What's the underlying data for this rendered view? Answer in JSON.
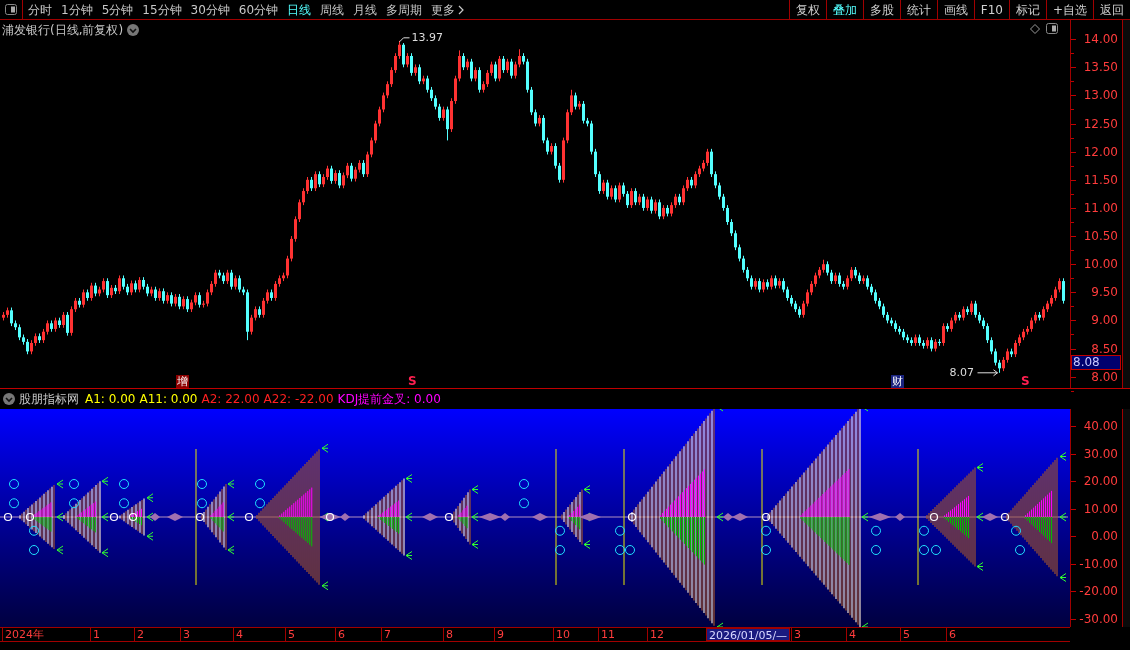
{
  "toolbar": {
    "periods": [
      {
        "label": "分时",
        "selected": false
      },
      {
        "label": "1分钟",
        "selected": false
      },
      {
        "label": "5分钟",
        "selected": false
      },
      {
        "label": "15分钟",
        "selected": false
      },
      {
        "label": "30分钟",
        "selected": false
      },
      {
        "label": "60分钟",
        "selected": false
      },
      {
        "label": "日线",
        "selected": true
      },
      {
        "label": "周线",
        "selected": false
      },
      {
        "label": "月线",
        "selected": false
      },
      {
        "label": "多周期",
        "selected": false
      }
    ],
    "more": "更多",
    "buttons": [
      {
        "label": "复权",
        "selected": false
      },
      {
        "label": "叠加",
        "selected": true
      },
      {
        "label": "多股",
        "selected": false
      },
      {
        "label": "统计",
        "selected": false
      },
      {
        "label": "画线",
        "selected": false
      },
      {
        "label": "F10",
        "selected": false
      },
      {
        "label": "标记",
        "selected": false
      },
      {
        "label": "+自选",
        "selected": false
      },
      {
        "label": "返回",
        "selected": false
      }
    ]
  },
  "chart": {
    "title": "浦发银行(日线,前复权)",
    "high_label": "13.97",
    "low_label": "8.07",
    "price_tag": "8.08",
    "markers": [
      {
        "text": "增",
        "kind": "event"
      },
      {
        "text": "S",
        "kind": "signal"
      },
      {
        "text": "财",
        "kind": "event"
      },
      {
        "text": "S",
        "kind": "signal"
      }
    ],
    "chart_data": {
      "type": "candlestick",
      "ohlc": [
        [
          9.05,
          9.15,
          9.0,
          9.1
        ],
        [
          9.1,
          9.23,
          9.05,
          9.18
        ],
        [
          9.18,
          9.23,
          8.9,
          8.95
        ],
        [
          8.95,
          9.0,
          8.83,
          8.88
        ],
        [
          8.88,
          8.93,
          8.65,
          8.7
        ],
        [
          8.7,
          8.75,
          8.57,
          8.62
        ],
        [
          8.62,
          8.67,
          8.4,
          8.45
        ],
        [
          8.45,
          8.65,
          8.4,
          8.6
        ],
        [
          8.6,
          8.77,
          8.55,
          8.72
        ],
        [
          8.72,
          8.77,
          8.6,
          8.65
        ],
        [
          8.65,
          8.85,
          8.6,
          8.8
        ],
        [
          8.8,
          9.0,
          8.75,
          8.95
        ],
        [
          8.95,
          9.0,
          8.8,
          8.85
        ],
        [
          8.85,
          9.05,
          8.8,
          9.0
        ],
        [
          9.0,
          9.05,
          8.87,
          8.92
        ],
        [
          8.92,
          9.15,
          8.87,
          9.1
        ],
        [
          9.1,
          9.15,
          8.73,
          8.78
        ],
        [
          8.78,
          9.25,
          8.73,
          9.2
        ],
        [
          9.2,
          9.4,
          9.15,
          9.35
        ],
        [
          9.35,
          9.4,
          9.23,
          9.28
        ],
        [
          9.28,
          9.55,
          9.23,
          9.5
        ],
        [
          9.5,
          9.55,
          9.35,
          9.4
        ],
        [
          9.4,
          9.67,
          9.35,
          9.62
        ],
        [
          9.62,
          9.67,
          9.43,
          9.48
        ],
        [
          9.48,
          9.6,
          9.43,
          9.55
        ],
        [
          9.55,
          9.75,
          9.5,
          9.7
        ],
        [
          9.7,
          9.75,
          9.4,
          9.45
        ],
        [
          9.45,
          9.63,
          9.4,
          9.58
        ],
        [
          9.58,
          9.63,
          9.47,
          9.52
        ],
        [
          9.52,
          9.8,
          9.47,
          9.75
        ],
        [
          9.75,
          9.8,
          9.55,
          9.6
        ],
        [
          9.6,
          9.65,
          9.45,
          9.5
        ],
        [
          9.5,
          9.71,
          9.45,
          9.66
        ],
        [
          9.66,
          9.71,
          9.5,
          9.55
        ],
        [
          9.55,
          9.77,
          9.5,
          9.72
        ],
        [
          9.72,
          9.77,
          9.55,
          9.6
        ],
        [
          9.6,
          9.65,
          9.43,
          9.48
        ],
        [
          9.48,
          9.6,
          9.43,
          9.55
        ],
        [
          9.55,
          9.6,
          9.35,
          9.4
        ],
        [
          9.4,
          9.57,
          9.35,
          9.52
        ],
        [
          9.52,
          9.57,
          9.3,
          9.35
        ],
        [
          9.35,
          9.5,
          9.3,
          9.45
        ],
        [
          9.45,
          9.5,
          9.25,
          9.3
        ],
        [
          9.3,
          9.47,
          9.25,
          9.42
        ],
        [
          9.42,
          9.47,
          9.2,
          9.25
        ],
        [
          9.25,
          9.43,
          9.2,
          9.38
        ],
        [
          9.38,
          9.43,
          9.15,
          9.2
        ],
        [
          9.2,
          9.37,
          9.15,
          9.32
        ],
        [
          9.32,
          9.5,
          9.27,
          9.45
        ],
        [
          9.45,
          9.5,
          9.23,
          9.28
        ],
        [
          9.28,
          9.35,
          9.23,
          9.3
        ],
        [
          9.3,
          9.55,
          9.25,
          9.5
        ],
        [
          9.5,
          9.7,
          9.45,
          9.65
        ],
        [
          9.65,
          9.9,
          9.6,
          9.85
        ],
        [
          9.85,
          9.9,
          9.75,
          9.8
        ],
        [
          9.8,
          9.85,
          9.65,
          9.7
        ],
        [
          9.7,
          9.9,
          9.65,
          9.85
        ],
        [
          9.85,
          9.9,
          9.55,
          9.6
        ],
        [
          9.6,
          9.8,
          9.55,
          9.75
        ],
        [
          9.75,
          9.8,
          9.5,
          9.55
        ],
        [
          9.55,
          9.6,
          9.45,
          9.5
        ],
        [
          9.5,
          9.55,
          8.65,
          8.8
        ],
        [
          8.8,
          9.1,
          8.75,
          9.05
        ],
        [
          9.05,
          9.25,
          9.0,
          9.2
        ],
        [
          9.2,
          9.25,
          9.05,
          9.1
        ],
        [
          9.1,
          9.4,
          9.05,
          9.35
        ],
        [
          9.35,
          9.55,
          9.3,
          9.5
        ],
        [
          9.5,
          9.55,
          9.35,
          9.4
        ],
        [
          9.4,
          9.7,
          9.35,
          9.65
        ],
        [
          9.65,
          9.8,
          9.6,
          9.75
        ],
        [
          9.75,
          9.85,
          9.7,
          9.8
        ],
        [
          9.8,
          10.15,
          9.75,
          10.1
        ],
        [
          10.1,
          10.5,
          10.05,
          10.45
        ],
        [
          10.45,
          10.85,
          10.4,
          10.8
        ],
        [
          10.8,
          11.15,
          10.75,
          11.1
        ],
        [
          11.1,
          11.35,
          11.05,
          11.3
        ],
        [
          11.3,
          11.55,
          11.25,
          11.5
        ],
        [
          11.5,
          11.55,
          11.3,
          11.35
        ],
        [
          11.35,
          11.65,
          11.3,
          11.6
        ],
        [
          11.6,
          11.65,
          11.37,
          11.42
        ],
        [
          11.42,
          11.6,
          11.37,
          11.55
        ],
        [
          11.55,
          11.75,
          11.5,
          11.7
        ],
        [
          11.7,
          11.75,
          11.43,
          11.48
        ],
        [
          11.48,
          11.67,
          11.43,
          11.62
        ],
        [
          11.62,
          11.67,
          11.35,
          11.4
        ],
        [
          11.4,
          11.63,
          11.35,
          11.58
        ],
        [
          11.58,
          11.8,
          11.53,
          11.75
        ],
        [
          11.75,
          11.8,
          11.47,
          11.52
        ],
        [
          11.52,
          11.73,
          11.47,
          11.68
        ],
        [
          11.68,
          11.85,
          11.63,
          11.8
        ],
        [
          11.8,
          11.85,
          11.55,
          11.6
        ],
        [
          11.6,
          12.0,
          11.55,
          11.95
        ],
        [
          11.95,
          12.25,
          11.9,
          12.2
        ],
        [
          12.2,
          12.55,
          12.15,
          12.5
        ],
        [
          12.5,
          12.8,
          12.45,
          12.75
        ],
        [
          12.75,
          13.05,
          12.7,
          13.0
        ],
        [
          13.0,
          13.25,
          12.95,
          13.2
        ],
        [
          13.2,
          13.5,
          13.15,
          13.45
        ],
        [
          13.45,
          13.75,
          13.4,
          13.7
        ],
        [
          13.7,
          13.97,
          13.65,
          13.9
        ],
        [
          13.9,
          13.93,
          13.5,
          13.55
        ],
        [
          13.55,
          13.75,
          13.5,
          13.7
        ],
        [
          13.7,
          13.75,
          13.35,
          13.4
        ],
        [
          13.4,
          13.55,
          13.35,
          13.5
        ],
        [
          13.5,
          13.55,
          13.2,
          13.25
        ],
        [
          13.25,
          13.35,
          13.2,
          13.3
        ],
        [
          13.3,
          13.35,
          13.05,
          13.1
        ],
        [
          13.1,
          13.15,
          12.9,
          12.95
        ],
        [
          12.95,
          13.0,
          12.75,
          12.8
        ],
        [
          12.8,
          12.85,
          12.55,
          12.6
        ],
        [
          12.6,
          12.8,
          12.55,
          12.75
        ],
        [
          12.75,
          12.8,
          12.2,
          12.4
        ],
        [
          12.4,
          12.95,
          12.35,
          12.9
        ],
        [
          12.9,
          13.35,
          12.85,
          13.3
        ],
        [
          13.3,
          13.8,
          13.25,
          13.7
        ],
        [
          13.7,
          13.75,
          13.45,
          13.5
        ],
        [
          13.5,
          13.65,
          13.45,
          13.6
        ],
        [
          13.6,
          13.65,
          13.25,
          13.3
        ],
        [
          13.3,
          13.5,
          13.25,
          13.45
        ],
        [
          13.45,
          13.5,
          13.05,
          13.1
        ],
        [
          13.1,
          13.25,
          13.05,
          13.2
        ],
        [
          13.2,
          13.45,
          13.15,
          13.4
        ],
        [
          13.4,
          13.6,
          13.35,
          13.55
        ],
        [
          13.55,
          13.6,
          13.25,
          13.3
        ],
        [
          13.3,
          13.7,
          13.25,
          13.65
        ],
        [
          13.65,
          13.7,
          13.4,
          13.45
        ],
        [
          13.45,
          13.65,
          13.4,
          13.6
        ],
        [
          13.6,
          13.65,
          13.3,
          13.35
        ],
        [
          13.35,
          13.6,
          13.3,
          13.55
        ],
        [
          13.55,
          13.82,
          13.5,
          13.7
        ],
        [
          13.7,
          13.75,
          13.55,
          13.6
        ],
        [
          13.6,
          13.65,
          13.05,
          13.1
        ],
        [
          13.1,
          13.15,
          12.65,
          12.7
        ],
        [
          12.7,
          12.75,
          12.45,
          12.5
        ],
        [
          12.5,
          12.65,
          12.45,
          12.6
        ],
        [
          12.6,
          12.65,
          12.15,
          12.2
        ],
        [
          12.2,
          12.25,
          11.95,
          12.0
        ],
        [
          12.0,
          12.15,
          11.95,
          12.1
        ],
        [
          12.1,
          12.15,
          11.7,
          11.75
        ],
        [
          11.75,
          11.8,
          11.45,
          11.5
        ],
        [
          11.5,
          12.25,
          11.45,
          12.2
        ],
        [
          12.2,
          12.75,
          12.15,
          12.7
        ],
        [
          12.7,
          13.1,
          12.65,
          13.0
        ],
        [
          13.0,
          13.05,
          12.75,
          12.8
        ],
        [
          12.8,
          12.9,
          12.75,
          12.85
        ],
        [
          12.85,
          12.9,
          12.5,
          12.55
        ],
        [
          12.55,
          12.6,
          12.45,
          12.5
        ],
        [
          12.5,
          12.55,
          11.95,
          12.0
        ],
        [
          12.0,
          12.05,
          11.55,
          11.6
        ],
        [
          11.6,
          11.65,
          11.25,
          11.3
        ],
        [
          11.3,
          11.5,
          11.25,
          11.45
        ],
        [
          11.45,
          11.5,
          11.15,
          11.2
        ],
        [
          11.2,
          11.4,
          11.15,
          11.35
        ],
        [
          11.35,
          11.4,
          11.1,
          11.15
        ],
        [
          11.15,
          11.45,
          11.1,
          11.4
        ],
        [
          11.4,
          11.45,
          11.2,
          11.25
        ],
        [
          11.25,
          11.3,
          11.0,
          11.05
        ],
        [
          11.05,
          11.35,
          11.0,
          11.3
        ],
        [
          11.3,
          11.35,
          11.05,
          11.1
        ],
        [
          11.1,
          11.25,
          11.05,
          11.2
        ],
        [
          11.2,
          11.25,
          10.95,
          11.0
        ],
        [
          11.0,
          11.2,
          10.95,
          11.15
        ],
        [
          11.15,
          11.2,
          10.9,
          10.95
        ],
        [
          10.95,
          11.15,
          10.9,
          11.1
        ],
        [
          11.1,
          11.15,
          10.8,
          10.85
        ],
        [
          10.85,
          11.05,
          10.8,
          11.0
        ],
        [
          11.0,
          11.05,
          10.85,
          10.9
        ],
        [
          10.9,
          11.1,
          10.85,
          11.05
        ],
        [
          11.05,
          11.25,
          11.0,
          11.2
        ],
        [
          11.2,
          11.25,
          11.05,
          11.1
        ],
        [
          11.1,
          11.4,
          11.05,
          11.35
        ],
        [
          11.35,
          11.55,
          11.3,
          11.5
        ],
        [
          11.5,
          11.55,
          11.35,
          11.4
        ],
        [
          11.4,
          11.65,
          11.35,
          11.6
        ],
        [
          11.6,
          11.75,
          11.55,
          11.7
        ],
        [
          11.7,
          11.85,
          11.65,
          11.8
        ],
        [
          11.8,
          12.05,
          11.75,
          12.0
        ],
        [
          12.0,
          12.05,
          11.55,
          11.6
        ],
        [
          11.6,
          11.65,
          11.35,
          11.4
        ],
        [
          11.4,
          11.45,
          11.15,
          11.2
        ],
        [
          11.2,
          11.25,
          10.95,
          11.0
        ],
        [
          11.0,
          11.05,
          10.7,
          10.75
        ],
        [
          10.75,
          10.8,
          10.5,
          10.55
        ],
        [
          10.55,
          10.6,
          10.25,
          10.3
        ],
        [
          10.3,
          10.35,
          10.05,
          10.1
        ],
        [
          10.1,
          10.15,
          9.85,
          9.9
        ],
        [
          9.9,
          9.95,
          9.7,
          9.75
        ],
        [
          9.75,
          9.8,
          9.55,
          9.6
        ],
        [
          9.6,
          9.75,
          9.55,
          9.7
        ],
        [
          9.7,
          9.75,
          9.5,
          9.55
        ],
        [
          9.55,
          9.73,
          9.5,
          9.68
        ],
        [
          9.68,
          9.73,
          9.55,
          9.6
        ],
        [
          9.6,
          9.8,
          9.55,
          9.75
        ],
        [
          9.75,
          9.8,
          9.57,
          9.62
        ],
        [
          9.62,
          9.75,
          9.57,
          9.7
        ],
        [
          9.7,
          9.75,
          9.5,
          9.55
        ],
        [
          9.55,
          9.6,
          9.35,
          9.4
        ],
        [
          9.4,
          9.45,
          9.25,
          9.3
        ],
        [
          9.3,
          9.35,
          9.15,
          9.2
        ],
        [
          9.2,
          9.25,
          9.05,
          9.1
        ],
        [
          9.1,
          9.35,
          9.05,
          9.3
        ],
        [
          9.3,
          9.55,
          9.25,
          9.5
        ],
        [
          9.5,
          9.7,
          9.45,
          9.65
        ],
        [
          9.65,
          9.85,
          9.6,
          9.8
        ],
        [
          9.8,
          9.95,
          9.75,
          9.9
        ],
        [
          9.9,
          10.08,
          9.85,
          10.0
        ],
        [
          10.0,
          10.05,
          9.8,
          9.85
        ],
        [
          9.85,
          9.9,
          9.65,
          9.7
        ],
        [
          9.7,
          9.85,
          9.65,
          9.8
        ],
        [
          9.8,
          9.85,
          9.6,
          9.65
        ],
        [
          9.65,
          9.7,
          9.55,
          9.6
        ],
        [
          9.6,
          9.8,
          9.55,
          9.75
        ],
        [
          9.75,
          9.95,
          9.7,
          9.9
        ],
        [
          9.9,
          9.95,
          9.75,
          9.8
        ],
        [
          9.8,
          9.85,
          9.65,
          9.7
        ],
        [
          9.7,
          9.8,
          9.65,
          9.75
        ],
        [
          9.75,
          9.8,
          9.55,
          9.6
        ],
        [
          9.6,
          9.65,
          9.45,
          9.5
        ],
        [
          9.5,
          9.55,
          9.3,
          9.35
        ],
        [
          9.35,
          9.4,
          9.2,
          9.25
        ],
        [
          9.25,
          9.3,
          9.05,
          9.1
        ],
        [
          9.1,
          9.15,
          8.95,
          9.0
        ],
        [
          9.0,
          9.05,
          8.9,
          8.95
        ],
        [
          8.95,
          9.0,
          8.8,
          8.85
        ],
        [
          8.85,
          8.9,
          8.75,
          8.8
        ],
        [
          8.8,
          8.85,
          8.65,
          8.7
        ],
        [
          8.7,
          8.75,
          8.6,
          8.65
        ],
        [
          8.65,
          8.7,
          8.55,
          8.6
        ],
        [
          8.6,
          8.75,
          8.55,
          8.7
        ],
        [
          8.7,
          8.75,
          8.55,
          8.6
        ],
        [
          8.6,
          8.65,
          8.5,
          8.55
        ],
        [
          8.55,
          8.7,
          8.5,
          8.65
        ],
        [
          8.65,
          8.7,
          8.45,
          8.5
        ],
        [
          8.5,
          8.67,
          8.45,
          8.62
        ],
        [
          8.62,
          8.67,
          8.55,
          8.6
        ],
        [
          8.6,
          8.95,
          8.55,
          8.9
        ],
        [
          8.9,
          8.95,
          8.8,
          8.85
        ],
        [
          8.85,
          9.05,
          8.8,
          9.0
        ],
        [
          9.0,
          9.15,
          8.95,
          9.1
        ],
        [
          9.1,
          9.15,
          9.0,
          9.05
        ],
        [
          9.05,
          9.25,
          9.0,
          9.2
        ],
        [
          9.2,
          9.25,
          9.1,
          9.15
        ],
        [
          9.15,
          9.35,
          9.1,
          9.3
        ],
        [
          9.3,
          9.35,
          9.05,
          9.1
        ],
        [
          9.1,
          9.15,
          8.95,
          9.0
        ],
        [
          9.0,
          9.05,
          8.85,
          8.9
        ],
        [
          8.9,
          8.95,
          8.6,
          8.65
        ],
        [
          8.65,
          8.7,
          8.4,
          8.45
        ],
        [
          8.45,
          8.5,
          8.2,
          8.25
        ],
        [
          8.25,
          8.3,
          8.07,
          8.15
        ],
        [
          8.15,
          8.35,
          8.1,
          8.3
        ],
        [
          8.3,
          8.5,
          8.25,
          8.45
        ],
        [
          8.45,
          8.5,
          8.35,
          8.4
        ],
        [
          8.4,
          8.65,
          8.35,
          8.6
        ],
        [
          8.6,
          8.75,
          8.55,
          8.7
        ],
        [
          8.7,
          8.85,
          8.65,
          8.8
        ],
        [
          8.8,
          8.9,
          8.75,
          8.85
        ],
        [
          8.85,
          9.05,
          8.8,
          9.0
        ],
        [
          9.0,
          9.15,
          8.95,
          9.1
        ],
        [
          9.1,
          9.15,
          9.0,
          9.05
        ],
        [
          9.05,
          9.25,
          9.0,
          9.2
        ],
        [
          9.2,
          9.35,
          9.15,
          9.3
        ],
        [
          9.3,
          9.45,
          9.25,
          9.4
        ],
        [
          9.4,
          9.6,
          9.35,
          9.55
        ],
        [
          9.55,
          9.75,
          9.5,
          9.7
        ],
        [
          9.7,
          9.75,
          9.3,
          9.35
        ]
      ],
      "ylim": [
        7.8,
        14.34
      ],
      "yticks": [
        {
          "value": 14,
          "label": "14.00"
        },
        {
          "value": 13.5,
          "label": "13.50"
        },
        {
          "value": 13,
          "label": "13.00"
        },
        {
          "value": 12.5,
          "label": "12.50"
        },
        {
          "value": 12,
          "label": "12.00"
        },
        {
          "value": 11.5,
          "label": "11.50"
        },
        {
          "value": 11,
          "label": "11.00"
        },
        {
          "value": 10.5,
          "label": "10.50"
        },
        {
          "value": 10,
          "label": "10.00"
        },
        {
          "value": 9.5,
          "label": "9.50"
        },
        {
          "value": 9,
          "label": "9.00"
        },
        {
          "value": 8.5,
          "label": "8.50"
        },
        {
          "value": 8,
          "label": "8.00"
        }
      ]
    }
  },
  "indicator": {
    "name": "股朋指标网",
    "values": [
      {
        "text": "A1: 0.00",
        "color": "#ffff00"
      },
      {
        "text": "A11: 0.00",
        "color": "#ffff00"
      },
      {
        "text": "A2: 22.00",
        "color": "#ff2020"
      },
      {
        "text": "A22: -22.00",
        "color": "#ff2020"
      },
      {
        "text": "KDJ提前金叉: 0.00",
        "color": "#ff00ff"
      }
    ],
    "y_ticks": [
      "40.00",
      "30.00",
      "20.00",
      "10.00",
      "0.00",
      "-10.00",
      "-20.00",
      "-30.00"
    ]
  },
  "x_axis": {
    "labels": [
      {
        "text": "2024年",
        "selected": false
      },
      {
        "text": "1",
        "selected": false
      },
      {
        "text": "2",
        "selected": false
      },
      {
        "text": "3",
        "selected": false
      },
      {
        "text": "4",
        "selected": false
      },
      {
        "text": "5",
        "selected": false
      },
      {
        "text": "6",
        "selected": false
      },
      {
        "text": "7",
        "selected": false
      },
      {
        "text": "8",
        "selected": false
      },
      {
        "text": "9",
        "selected": false
      },
      {
        "text": "10",
        "selected": false
      },
      {
        "text": "11",
        "selected": false
      },
      {
        "text": "12",
        "selected": false
      },
      {
        "text": "2026/01/05/—",
        "selected": true
      },
      {
        "text": "3",
        "selected": false
      },
      {
        "text": "4",
        "selected": false
      },
      {
        "text": "5",
        "selected": false
      },
      {
        "text": "6",
        "selected": false
      }
    ]
  }
}
